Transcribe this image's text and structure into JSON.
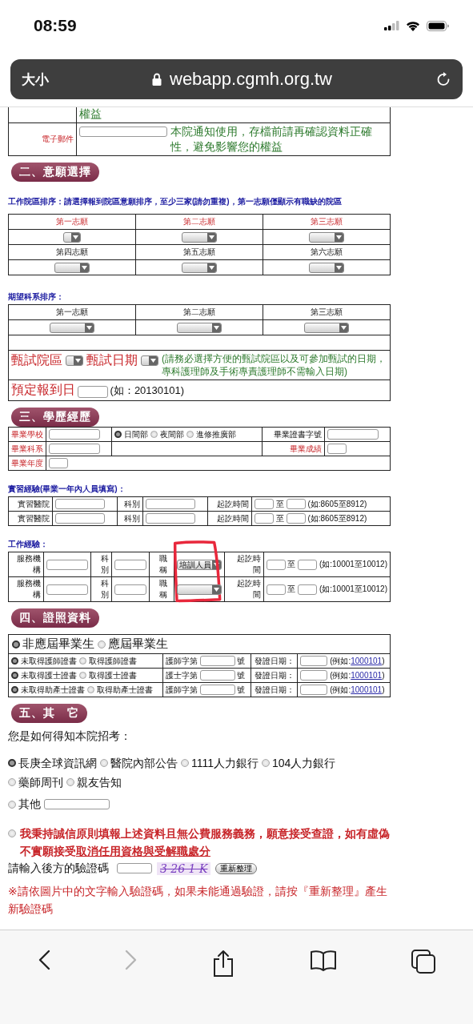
{
  "status_bar": {
    "time": "08:59"
  },
  "browser": {
    "text_size_button": "大小",
    "url": "webapp.cgmh.org.tw"
  },
  "contact": {
    "cut_row_note": "權益",
    "email_label": "電子郵件",
    "email_note": "本院通知使用，存檔前請再確認資料正確性，避免影響您的權益"
  },
  "preferences": {
    "header": "二、意願選擇",
    "campus_instruction": "工作院區排序：請選擇報到院區意願排序，至少三家(請勿重複)，第一志願僅顯示有職缺的院區",
    "campus_choices": [
      {
        "label": "第一志願",
        "required": true
      },
      {
        "label": "第二志願",
        "required": true
      },
      {
        "label": "第三志願",
        "required": true
      },
      {
        "label": "第四志願",
        "required": false
      },
      {
        "label": "第五志願",
        "required": false
      },
      {
        "label": "第六志願",
        "required": false
      }
    ],
    "department_title": "期望科系排序：",
    "department_choices": [
      {
        "label": "第一志願"
      },
      {
        "label": "第二志願"
      },
      {
        "label": "第三志願"
      }
    ],
    "interview_campus_label": "甄試院區",
    "interview_date_label": "甄試日期",
    "interview_note": "(請務必選擇方便的甄試院區以及可參加甄試的日期，專科護理師及手術專責護理師不需輸入日期)",
    "report_date_label": "預定報到日",
    "report_date_hint": "(如：20130101)"
  },
  "education": {
    "header": "三、學歷經歷",
    "school_label": "畢業學校",
    "divisions": [
      {
        "label": "日間部",
        "selected": true
      },
      {
        "label": "夜間部",
        "selected": false
      },
      {
        "label": "進修推廣部",
        "selected": false
      }
    ],
    "certificate_no_label": "畢業證書字號",
    "major_label": "畢業科系",
    "grade_label": "畢業成績",
    "year_label": "畢業年度"
  },
  "internship": {
    "title": "實習經驗(畢業一年內人員填寫)：",
    "rows": [
      {
        "hospital_label": "實習醫院",
        "department_label": "科別",
        "period_label": "起訖時間",
        "to_label": "至",
        "example": "(如:8605至8912)"
      },
      {
        "hospital_label": "實習醫院",
        "department_label": "科別",
        "period_label": "起訖時間",
        "to_label": "至",
        "example": "(如:8605至8912)"
      }
    ]
  },
  "work": {
    "title": "工作經驗：",
    "highlight_mark": true,
    "rows": [
      {
        "org_label": "服務機構",
        "department_label": "科別",
        "title_label": "職稱",
        "title_value": "培訓人員",
        "period_label": "起訖時間",
        "to_label": "至",
        "example": "(如:10001至10012)"
      },
      {
        "org_label": "服務機構",
        "department_label": "科別",
        "title_label": "職稱",
        "period_label": "起訖時間",
        "to_label": "至",
        "example": "(如:10001至10012)"
      }
    ]
  },
  "licenses": {
    "header": "四、證照資料",
    "graduate_status": [
      {
        "label": "非應屆畢業生",
        "selected": true
      },
      {
        "label": "應屆畢業生",
        "selected": false
      }
    ],
    "rows": [
      {
        "options": [
          {
            "label": "未取得護師證書",
            "selected": true
          },
          {
            "label": "取得護師證書",
            "selected": false
          }
        ],
        "number_label": "護師字第",
        "number_suffix": "號",
        "date_label": "發證日期：",
        "example_prefix": "(例如:",
        "example_link": "1000101",
        "example_suffix": ")"
      },
      {
        "options": [
          {
            "label": "未取得護士證書",
            "selected": true
          },
          {
            "label": "取得護士證書",
            "selected": false
          }
        ],
        "number_label": "護士字第",
        "number_suffix": "號",
        "date_label": "發證日期：",
        "example_prefix": "(例如:",
        "example_link": "1000101",
        "example_suffix": ")"
      },
      {
        "options": [
          {
            "label": "未取得助產士證書",
            "selected": true
          },
          {
            "label": "取得助產士證書",
            "selected": false
          }
        ],
        "number_label": "護師字第",
        "number_suffix": "號",
        "date_label": "發證日期：",
        "example_prefix": "(例如:",
        "example_link": "1000101",
        "example_suffix": ")"
      }
    ]
  },
  "other": {
    "header": "五、其　它",
    "question": "您是如何得知本院招考：",
    "sources": [
      {
        "label": "長庚全球資訊網",
        "selected": true
      },
      {
        "label": "醫院內部公告",
        "selected": false
      },
      {
        "label": "1111人力銀行",
        "selected": false
      },
      {
        "label": "104人力銀行",
        "selected": false
      },
      {
        "label": "藥師周刊",
        "selected": false
      },
      {
        "label": "親友告知",
        "selected": false
      }
    ],
    "other_option": {
      "label": "其他",
      "selected": false
    }
  },
  "pledge": {
    "selected": false,
    "text": "我秉持誠信原則填報上述資料且無公費服務義務，願意接受查證，如有虛偽不實願接受",
    "underlined_text": "取消任用資格與受解職處分"
  },
  "captcha": {
    "label": "請輸入後方的驗證碼",
    "code": "3 26 1 K",
    "refresh_button": "重新整理",
    "note": "※請依圖片中的文字輸入驗證碼，如果未能通過驗證，請按『重新整理』產生新驗證碼"
  },
  "toolbar": {
    "back_enabled": true,
    "forward_enabled": false
  }
}
